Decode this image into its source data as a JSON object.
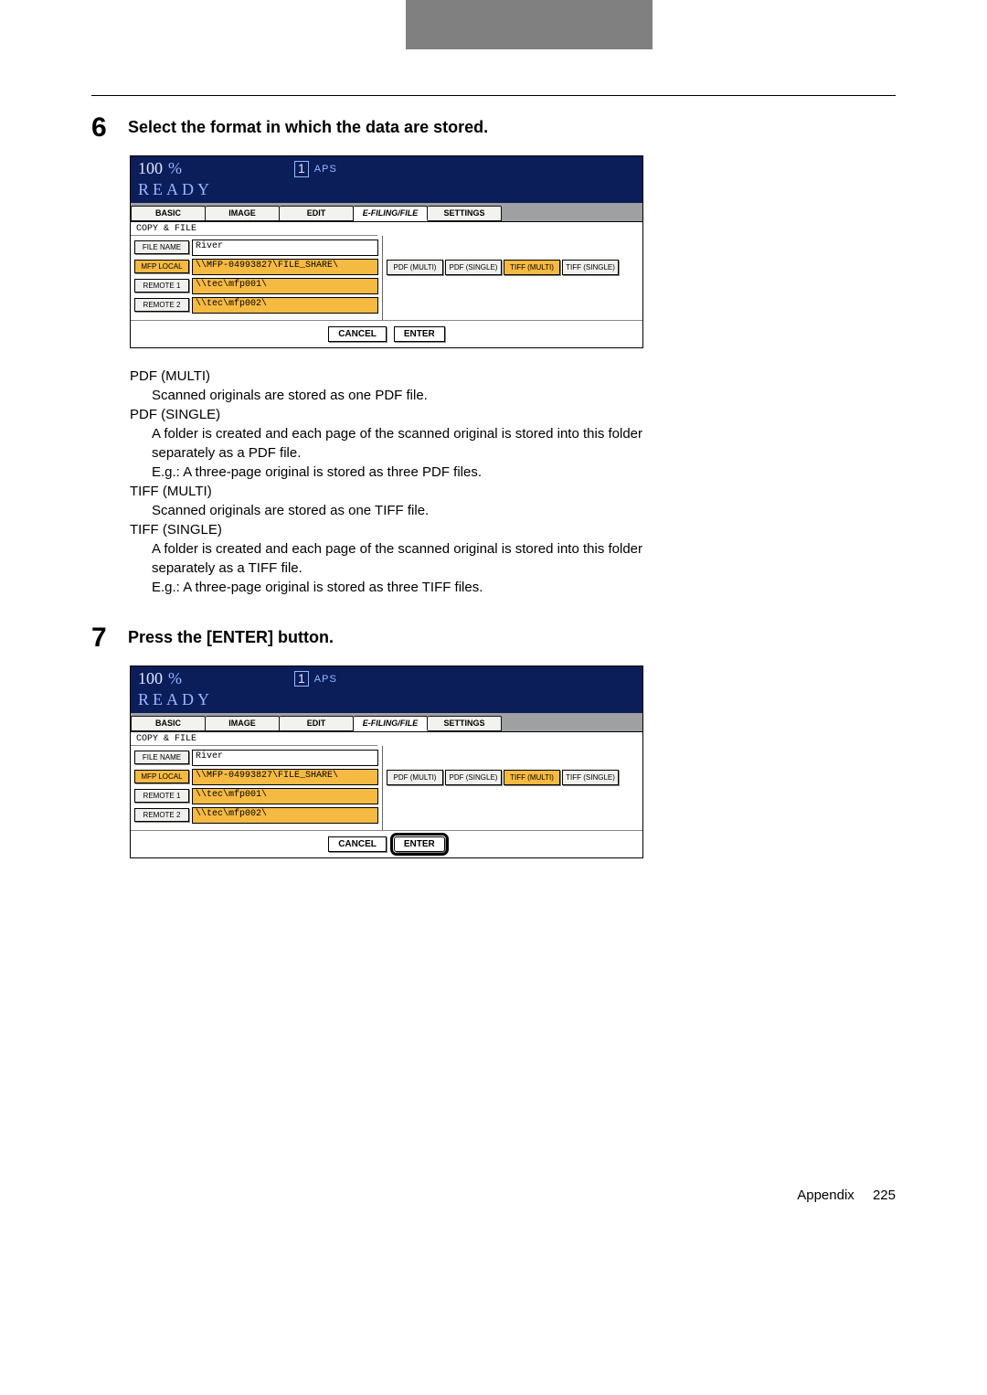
{
  "step6": {
    "num": "6",
    "title": "Select the format in which the data are stored."
  },
  "step7": {
    "num": "7",
    "title": "Press the [ENTER] button."
  },
  "panel": {
    "percent": "100",
    "pct_sign": "%",
    "one": "1",
    "aps": "APS",
    "ready": "READY",
    "tabs": {
      "basic": "BASIC",
      "image": "IMAGE",
      "edit": "EDIT",
      "efiling": "E-FILING/FILE",
      "settings": "SETTINGS"
    },
    "mode": "COPY & FILE",
    "rows": {
      "filename": "FILE NAME",
      "filename_val": "River",
      "mfplocal": "MFP LOCAL",
      "mfplocal_val": "\\\\MFP-04993827\\FILE_SHARE\\",
      "remote1": "REMOTE 1",
      "remote1_val": "\\\\tec\\mfp001\\",
      "remote2": "REMOTE 2",
      "remote2_val": "\\\\tec\\mfp002\\"
    },
    "formats": {
      "pdf_multi": "PDF (MULTI)",
      "pdf_single": "PDF (SINGLE)",
      "tiff_multi": "TIFF (MULTI)",
      "tiff_single": "TIFF (SINGLE)"
    },
    "cancel": "CANCEL",
    "enter": "ENTER"
  },
  "desc": {
    "pdf_multi_t": "PDF (MULTI)",
    "pdf_multi_d": "Scanned originals are stored as one PDF file.",
    "pdf_single_t": "PDF (SINGLE)",
    "pdf_single_d1": "A folder is created and each page of the scanned original is stored into this folder separately as a PDF file.",
    "pdf_single_d2": "E.g.: A three-page original is stored as three PDF files.",
    "tiff_multi_t": "TIFF (MULTI)",
    "tiff_multi_d": "Scanned originals are stored as one TIFF file.",
    "tiff_single_t": "TIFF (SINGLE)",
    "tiff_single_d1": "A folder is created and each page of the scanned original is stored into this folder separately as a TIFF file.",
    "tiff_single_d2": "E.g.: A three-page original is stored as three TIFF files."
  },
  "footer": {
    "section": "Appendix",
    "page": "225"
  }
}
